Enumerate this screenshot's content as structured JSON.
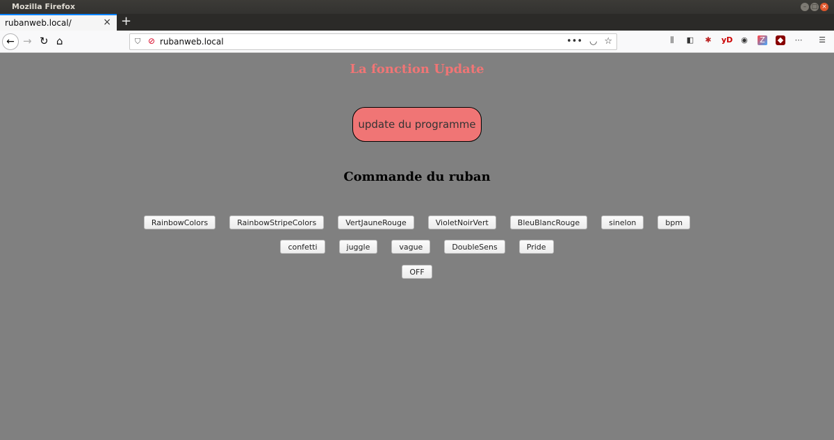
{
  "window": {
    "title": "Mozilla Firefox"
  },
  "tab": {
    "label": "rubanweb.local/",
    "close": "×",
    "new_tab": "+"
  },
  "navbar": {
    "url": "rubanweb.local",
    "more": "•••"
  },
  "extensions": {
    "yd": "yD"
  },
  "page": {
    "update_heading": "La fonction Update",
    "update_button": "update du programme",
    "command_heading": "Commande du ruban",
    "rows": [
      [
        "RainbowColors",
        "RainbowStripeColors",
        "VertJauneRouge",
        "VioletNoirVert",
        "BleuBlancRouge",
        "sinelon",
        "bpm"
      ],
      [
        "confetti",
        "juggle",
        "vague",
        "DoubleSens",
        "Pride"
      ],
      [
        "OFF"
      ]
    ]
  },
  "colors": {
    "accent": "#f07575",
    "background": "#808080"
  }
}
